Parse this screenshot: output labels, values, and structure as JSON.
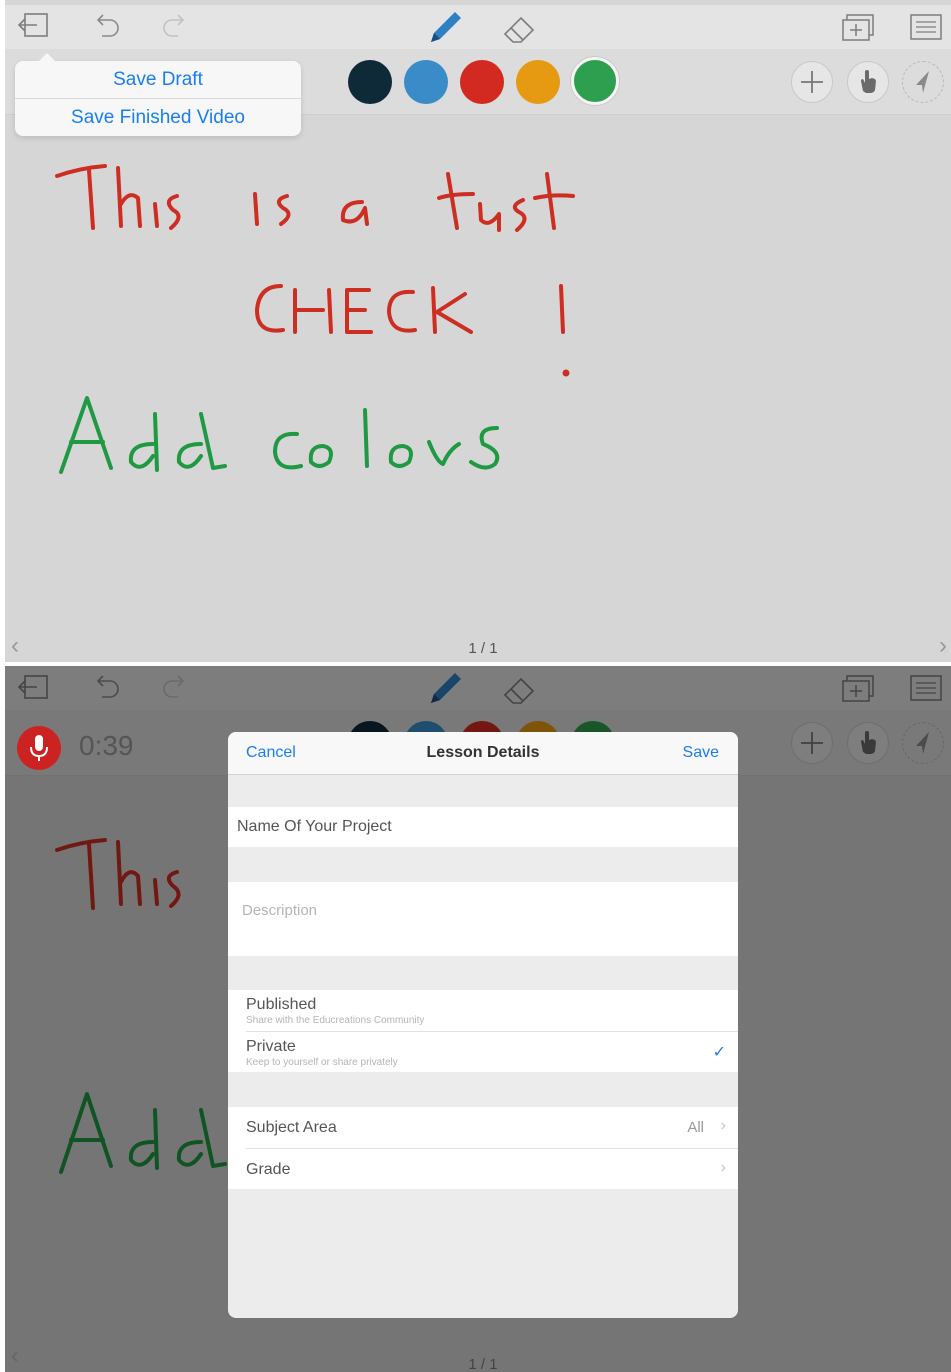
{
  "panel1": {
    "toolbar": {
      "icons": [
        "exit-icon",
        "undo-icon",
        "redo-icon",
        "pen-icon",
        "eraser-icon",
        "add-page-icon",
        "pages-icon"
      ]
    },
    "colors": [
      "#0e2a39",
      "#3a8cc8",
      "#d22a20",
      "#e59a12",
      "#2e9f4e"
    ],
    "popover": {
      "save_draft": "Save Draft",
      "save_finished": "Save Finished Video"
    },
    "page_count": "1 / 1",
    "handwriting_colors": {
      "red": "#cc2e22",
      "green": "#1f9a42"
    }
  },
  "panel2": {
    "timer": "0:39",
    "modal": {
      "cancel": "Cancel",
      "title": "Lesson Details",
      "save": "Save",
      "name_placeholder": "Name Of Your Project",
      "description_placeholder": "Description",
      "published": {
        "label": "Published",
        "sub": "Share with the Educreations Community"
      },
      "private": {
        "label": "Private",
        "sub": "Keep to yourself or share privately"
      },
      "subject": {
        "label": "Subject Area",
        "value": "All"
      },
      "grade": {
        "label": "Grade"
      }
    },
    "page_count": "1 / 1"
  }
}
